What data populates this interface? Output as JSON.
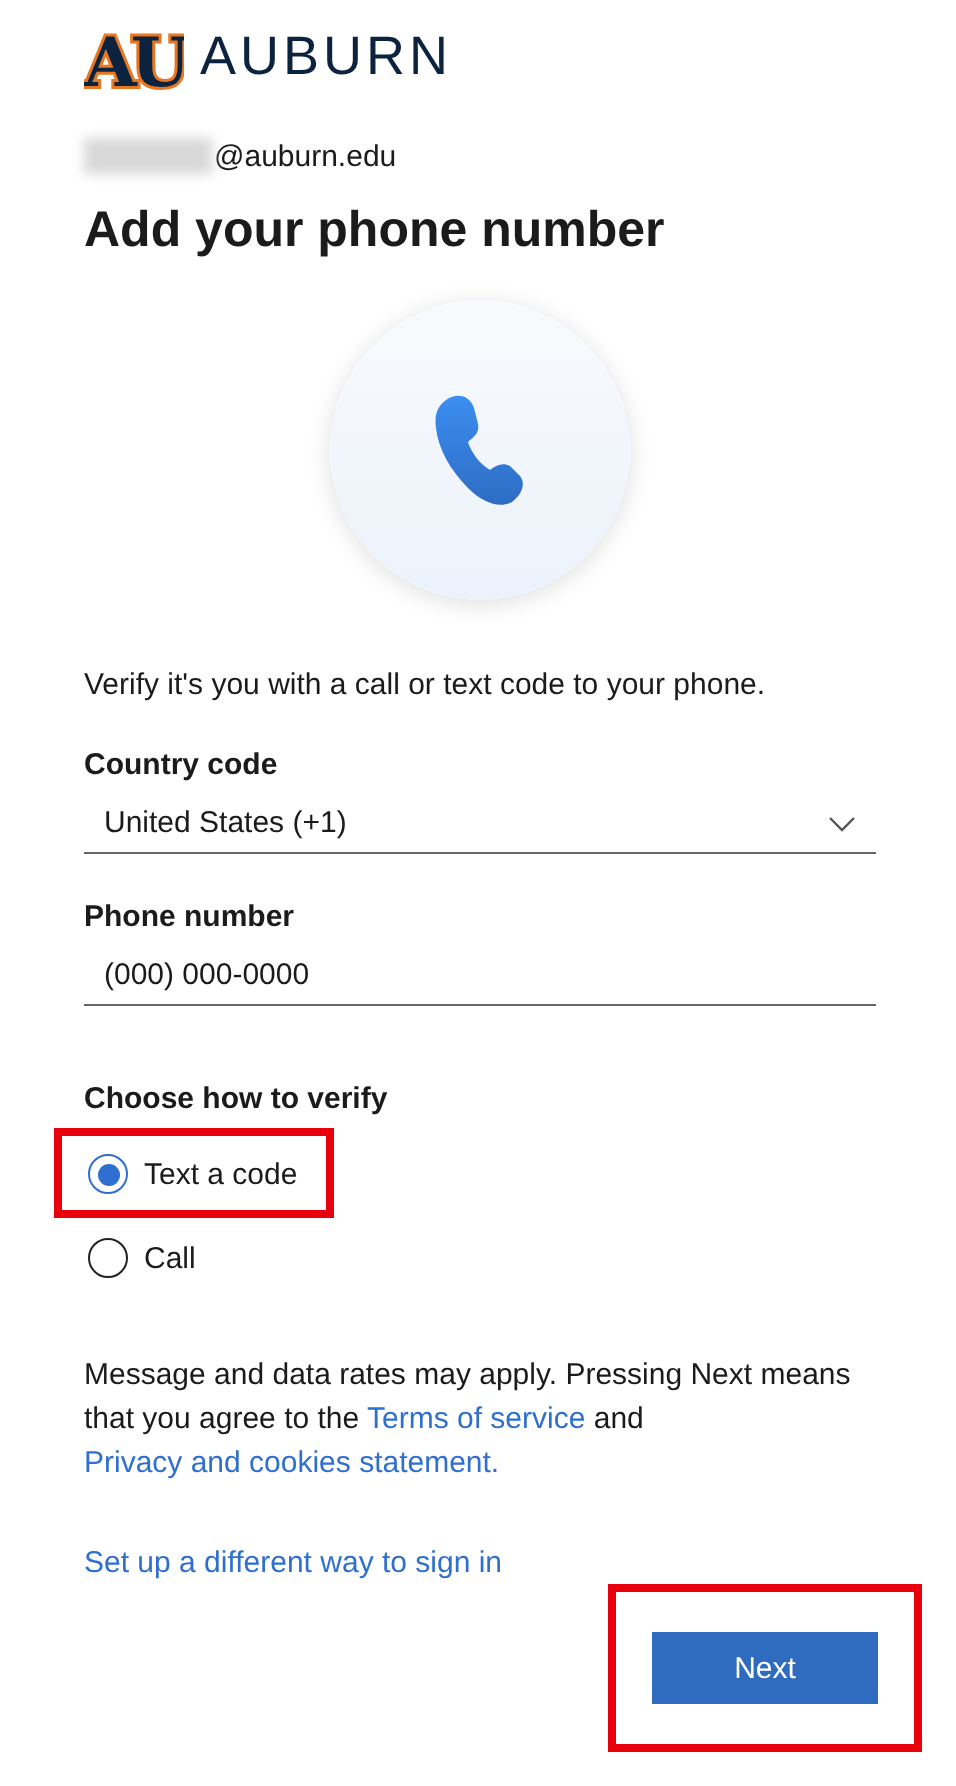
{
  "logo": {
    "monogram": "AU",
    "wordmark": "AUBURN"
  },
  "account": {
    "email_suffix": "@auburn.edu",
    "redacted": true
  },
  "title": "Add your phone number",
  "description": "Verify it's you with a call or text code to your phone.",
  "country_code": {
    "label": "Country code",
    "value": "United States (+1)"
  },
  "phone_number": {
    "label": "Phone number",
    "placeholder": "(000) 000-0000"
  },
  "verify": {
    "label": "Choose how to verify",
    "options": [
      {
        "label": "Text a code",
        "selected": true,
        "highlighted": true
      },
      {
        "label": "Call",
        "selected": false,
        "highlighted": false
      }
    ]
  },
  "notice": [
    {
      "kind": "text",
      "text": "Message and data rates may apply. Pressing Next means that you agree to the "
    },
    {
      "kind": "link",
      "text": "Terms of service"
    },
    {
      "kind": "text",
      "text": " and "
    },
    {
      "kind": "link",
      "text": "Privacy and cookies statement."
    }
  ],
  "alternate_link": "Set up a different way to sign in",
  "next_button": {
    "label": "Next",
    "highlighted": true
  }
}
